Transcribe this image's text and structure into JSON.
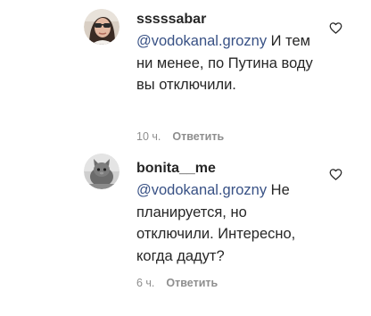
{
  "comments": [
    {
      "username": "sssssabar",
      "mention": "@vodokanal.grozny",
      "text": " И тем ни менее, по Путина воду вы отключили.",
      "time": "10 ч.",
      "reply_label": "Ответить",
      "like_icon": "heart-outline-icon"
    },
    {
      "username": "bonita__me",
      "mention": "@vodokanal.grozny",
      "text": " Не планируется, но отключили. Интересно, когда дадут?",
      "time": "6 ч.",
      "reply_label": "Ответить",
      "like_icon": "heart-outline-icon"
    }
  ],
  "colors": {
    "text": "#262626",
    "mention": "#385185",
    "meta": "#8e8e8e"
  }
}
